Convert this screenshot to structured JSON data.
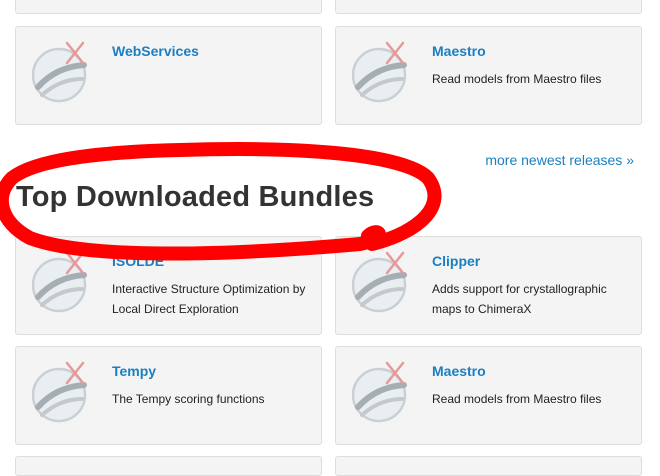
{
  "colors": {
    "link": "#1a7fc0",
    "annotation": "#ff0000",
    "card_bg": "#f4f4f4"
  },
  "icons": {
    "bundle_logo": "chimerax-logo-icon"
  },
  "newest_bundles": [
    {
      "name": "WebServices",
      "description": ""
    },
    {
      "name": "Maestro",
      "description": "Read models from Maestro files"
    }
  ],
  "more_link": "more newest releases »",
  "section_heading": "Top Downloaded Bundles",
  "top_bundles": [
    {
      "name": "ISOLDE",
      "description": "Interactive Structure Optimization by Local Direct Exploration"
    },
    {
      "name": "Clipper",
      "description": "Adds support for crystallographic maps to ChimeraX"
    },
    {
      "name": "Tempy",
      "description": "The Tempy scoring functions"
    },
    {
      "name": "Maestro",
      "description": "Read models from Maestro files"
    }
  ]
}
